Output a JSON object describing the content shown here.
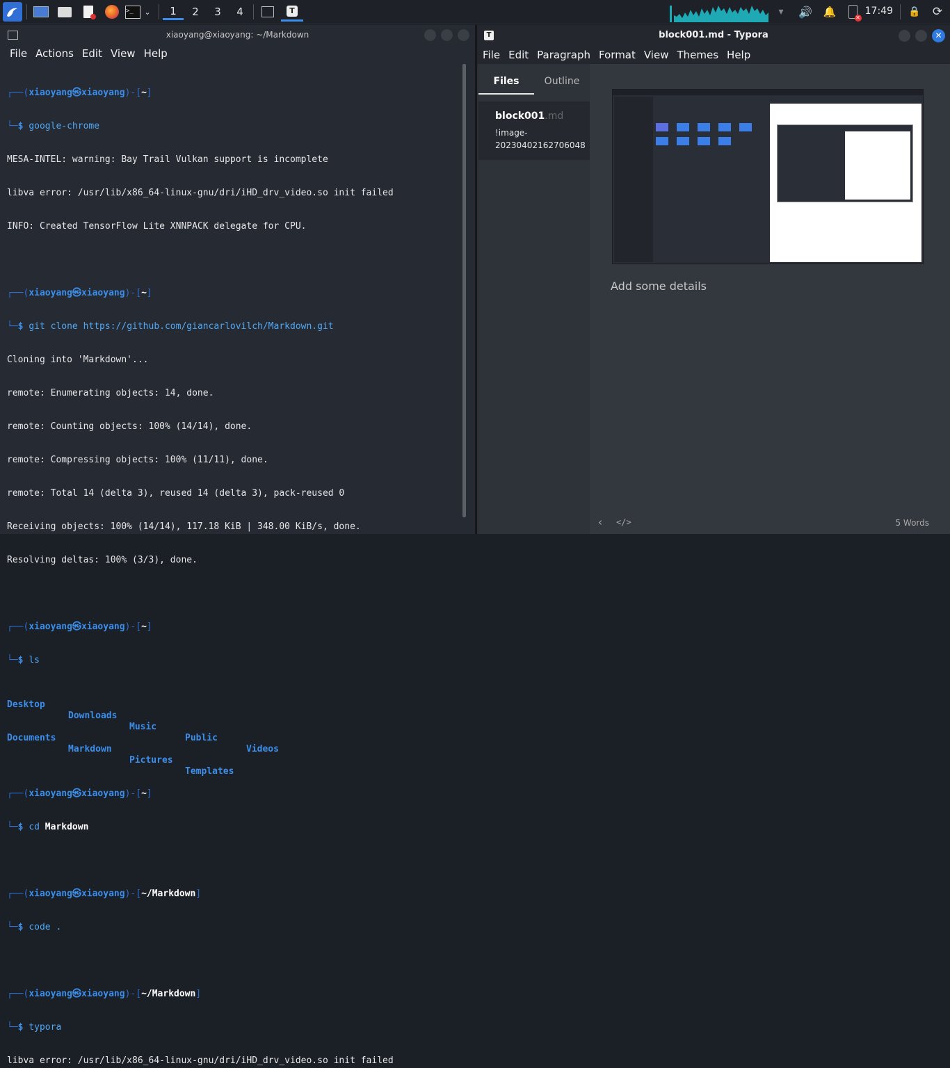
{
  "taskbar": {
    "workspaces": [
      "1",
      "2",
      "3",
      "4"
    ],
    "clock": "17:49"
  },
  "terminal": {
    "title": "xiaoyang@xiaoyang: ~/Markdown",
    "menu": [
      "File",
      "Actions",
      "Edit",
      "View",
      "Help"
    ],
    "user": "xiaoyang",
    "host": "xiaoyang",
    "lines": {
      "p1_dir": "~",
      "c1": "google-chrome",
      "o1": "MESA-INTEL: warning: Bay Trail Vulkan support is incomplete",
      "o2": "libva error: /usr/lib/x86_64-linux-gnu/dri/iHD_drv_video.so init failed",
      "o3": "INFO: Created TensorFlow Lite XNNPACK delegate for CPU.",
      "p2_dir": "~",
      "c2": "git clone https://github.com/giancarlovilch/Markdown.git",
      "o4": "Cloning into 'Markdown'...",
      "o5": "remote: Enumerating objects: 14, done.",
      "o6": "remote: Counting objects: 100% (14/14), done.",
      "o7": "remote: Compressing objects: 100% (11/11), done.",
      "o8": "remote: Total 14 (delta 3), reused 14 (delta 3), pack-reused 0",
      "o9": "Receiving objects: 100% (14/14), 117.18 KiB | 348.00 KiB/s, done.",
      "o10": "Resolving deltas: 100% (3/3), done.",
      "p3_dir": "~",
      "c3": "ls",
      "ls_row1": [
        "Desktop",
        "Downloads",
        "Music",
        "Public",
        "Videos"
      ],
      "ls_row2": [
        "Documents",
        "Markdown",
        "Pictures",
        "Templates"
      ],
      "p4_dir": "~",
      "c4": "cd",
      "c4_arg": "Markdown",
      "p5_dir": "~/Markdown",
      "c5": "code .",
      "p6_dir": "~/Markdown",
      "c6": "typora",
      "o11": "libva error: /usr/lib/x86_64-linux-gnu/dri/iHD_drv_video.so init failed"
    }
  },
  "typora": {
    "title": "block001.md - Typora",
    "menu": [
      "File",
      "Edit",
      "Paragraph",
      "Format",
      "View",
      "Themes",
      "Help"
    ],
    "tabs": [
      "Files",
      "Outline"
    ],
    "file": {
      "name": "block001",
      "ext": ".md",
      "preview_line1": "!image-",
      "preview_line2": "20230402162706048"
    },
    "editor_text": "Add some details",
    "word_count": "5 Words"
  }
}
